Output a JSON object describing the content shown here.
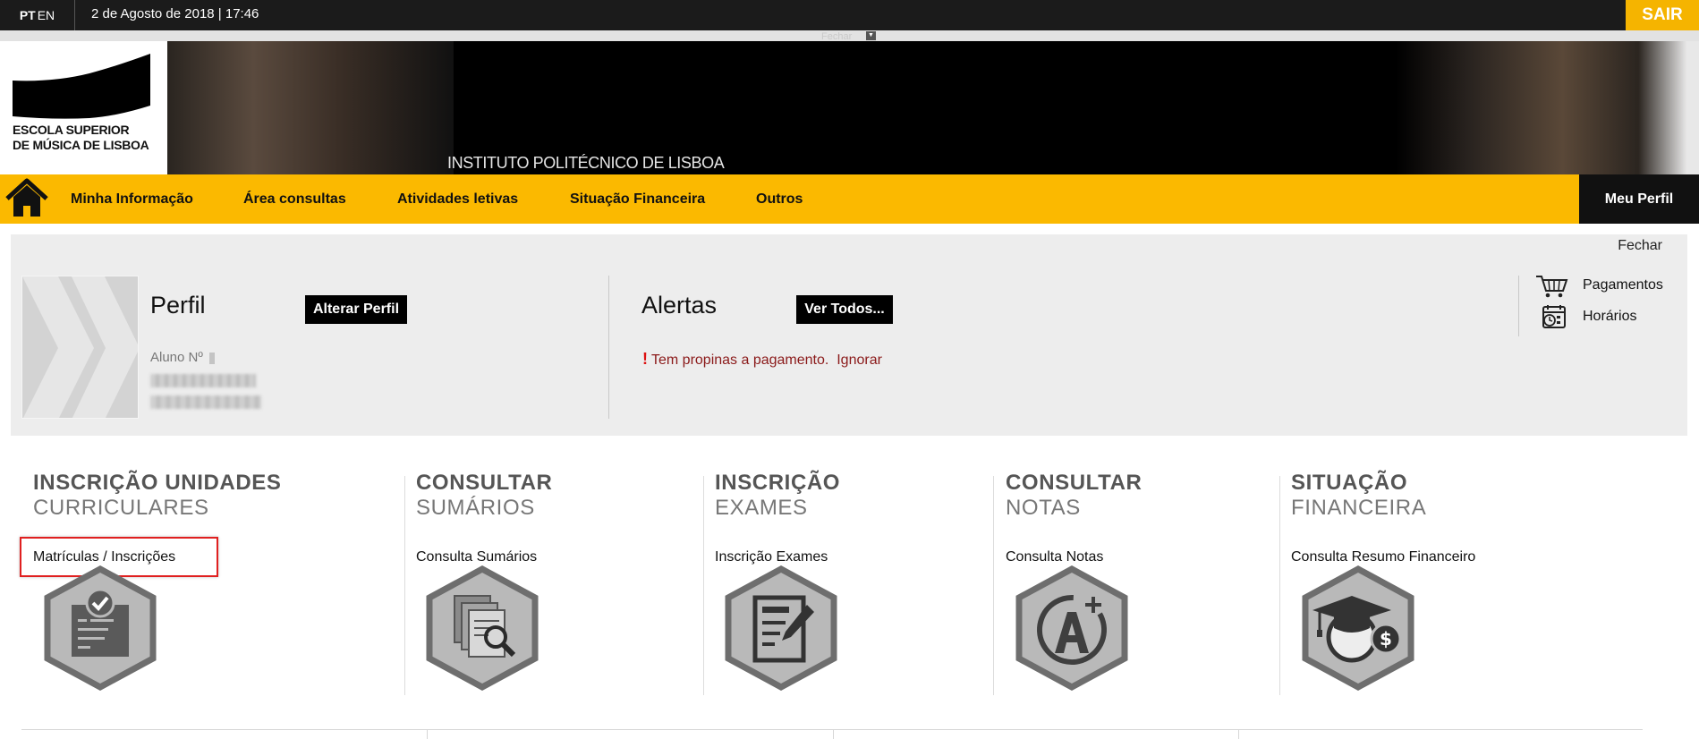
{
  "topbar": {
    "lang_pt": "PT",
    "lang_en": "EN",
    "datetime": "2 de Agosto de 2018 | 17:46",
    "logout": "SAIR"
  },
  "strip": {
    "label": "Fechar"
  },
  "banner": {
    "logo_line1": "ESCOLA SUPERIOR",
    "logo_line2": "DE MÚSICA DE LISBOA",
    "institute": "INSTITUTO POLITÉCNICO DE LISBOA"
  },
  "nav": {
    "items": [
      {
        "label": "Minha Informação"
      },
      {
        "label": "Área consultas"
      },
      {
        "label": "Atividades letivas"
      },
      {
        "label": "Situação Financeira"
      },
      {
        "label": "Outros"
      }
    ],
    "profile": "Meu Perfil"
  },
  "profile_panel": {
    "close": "Fechar",
    "title": "Perfil",
    "change_profile": "Alterar Perfil",
    "student_label": "Aluno Nº",
    "alerts_title": "Alertas",
    "view_all": "Ver Todos...",
    "alert_text": "Tem propinas a pagamento.",
    "alert_ignore": "Ignorar",
    "quick_links": [
      {
        "label": "Pagamentos",
        "icon": "cart-icon"
      },
      {
        "label": "Horários",
        "icon": "calendar-clock-icon"
      }
    ]
  },
  "tiles": [
    {
      "line1": "INSCRIÇÃO UNIDADES",
      "line2": "CURRICULARES",
      "link": "Matrículas / Inscrições",
      "icon": "clipboard-check-icon"
    },
    {
      "line1": "CONSULTAR",
      "line2": "SUMÁRIOS",
      "link": "Consulta Sumários",
      "icon": "documents-search-icon"
    },
    {
      "line1": "INSCRIÇÃO",
      "line2": "EXAMES",
      "link": "Inscrição Exames",
      "icon": "form-pen-icon"
    },
    {
      "line1": "CONSULTAR",
      "line2": "NOTAS",
      "link": "Consulta Notas",
      "icon": "grade-a-plus-icon"
    },
    {
      "line1": "SITUAÇÃO",
      "line2": "FINANCEIRA",
      "link": "Consulta Resumo Financeiro",
      "icon": "graduation-money-icon"
    }
  ],
  "colors": {
    "accent": "#fbb900",
    "dark": "#1b1b1b",
    "alert": "#8b1a1a",
    "highlight": "#e02020"
  }
}
